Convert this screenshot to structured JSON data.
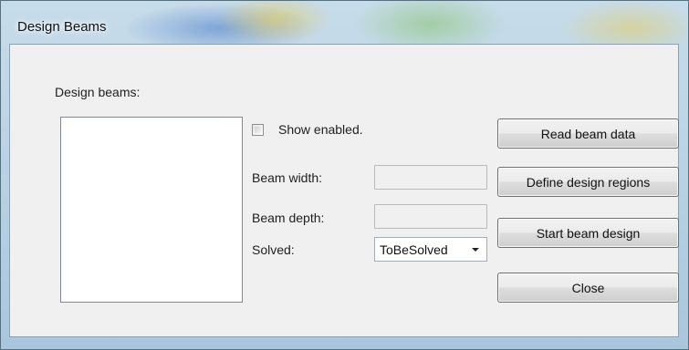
{
  "window": {
    "title": "Design Beams"
  },
  "form": {
    "list_label": "Design beams:",
    "show_enabled_label": "Show enabled.",
    "show_enabled_checked": false,
    "beam_width_label": "Beam width:",
    "beam_width_value": "",
    "beam_depth_label": "Beam depth:",
    "beam_depth_value": "",
    "solved_label": "Solved:",
    "solved_value": "ToBeSolved"
  },
  "buttons": {
    "read_beam_data": "Read beam data",
    "define_design_regions": "Define design regions",
    "start_beam_design": "Start beam design",
    "close": "Close"
  }
}
